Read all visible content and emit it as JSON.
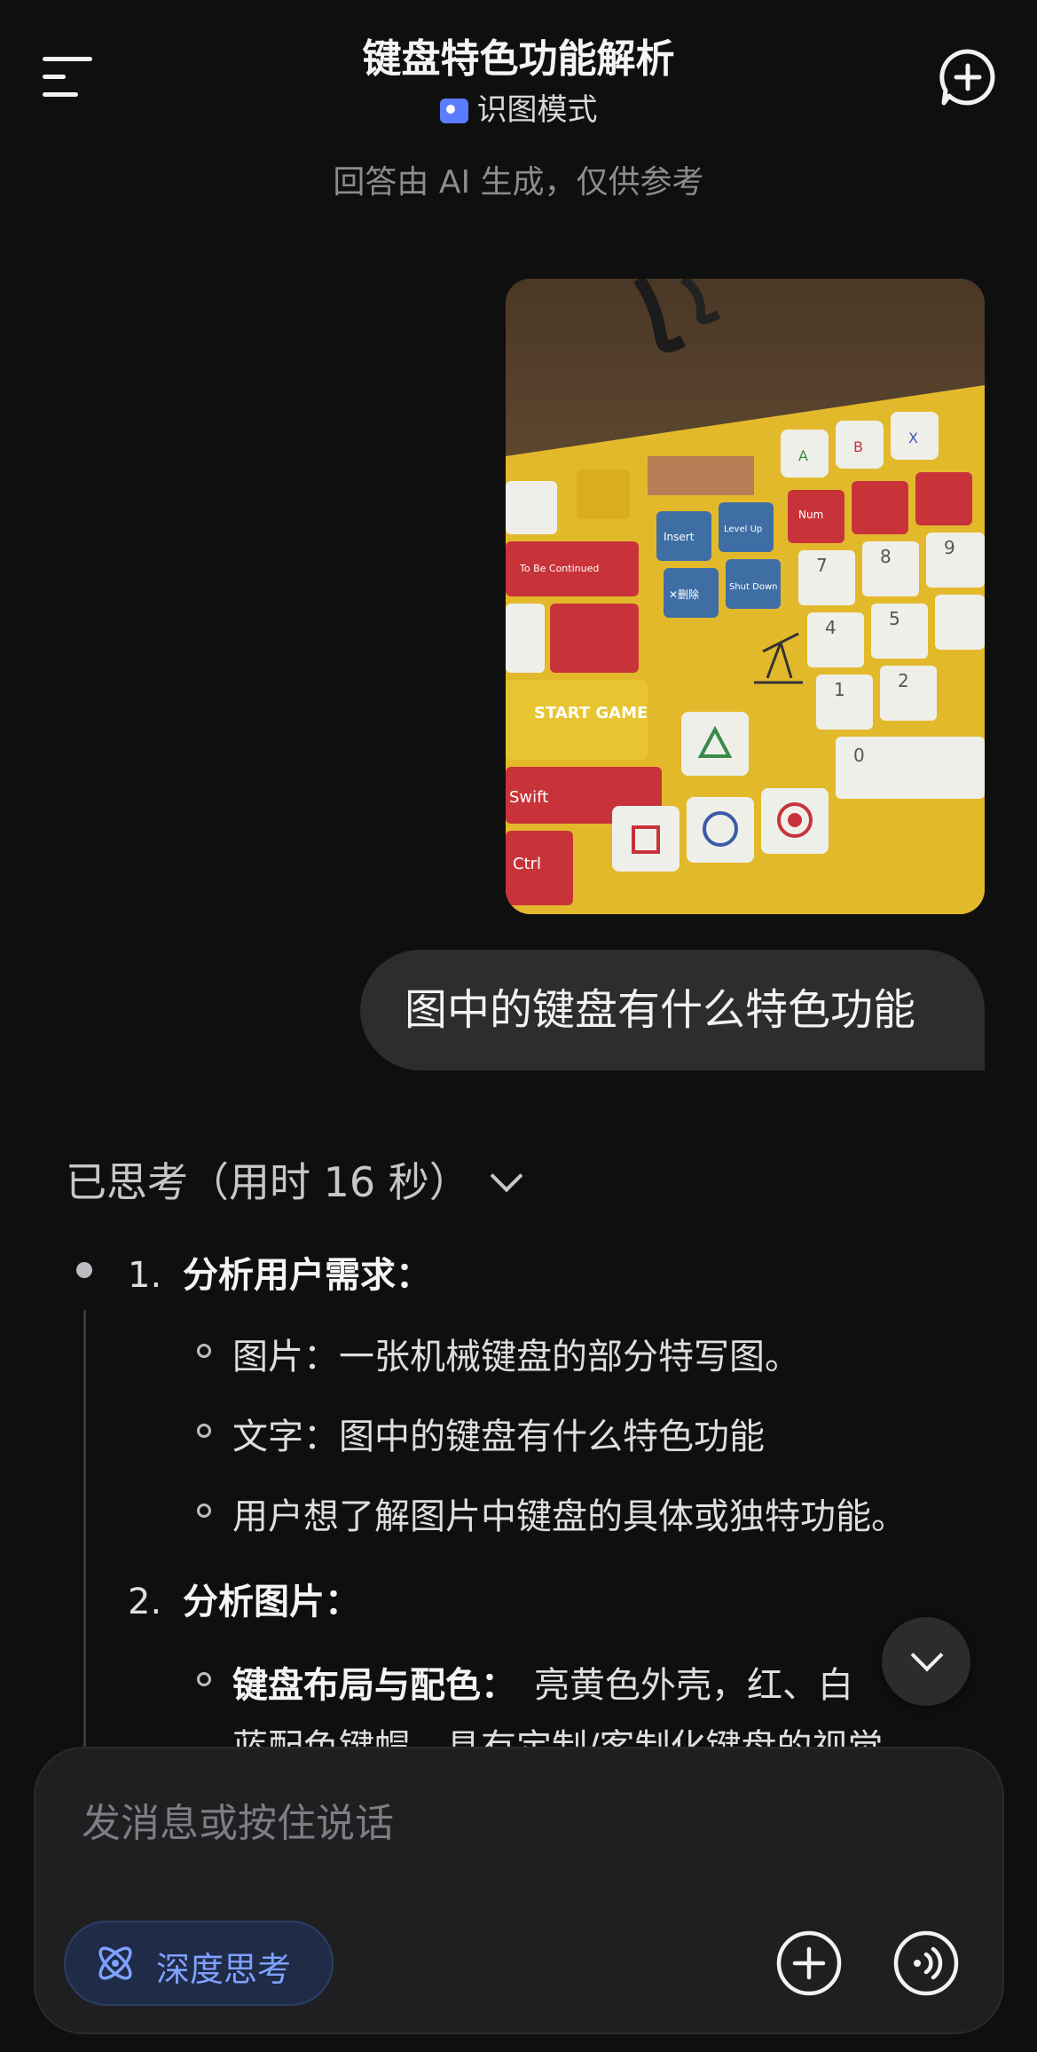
{
  "header": {
    "title": "键盘特色功能解析",
    "mode_label": "识图模式"
  },
  "disclaimer": "回答由 AI 生成，仅供参考",
  "user_message": "图中的键盘有什么特色功能",
  "thinking": {
    "header": "已思考（用时 16 秒）",
    "steps": [
      {
        "num": "1.",
        "title": "分析用户需求：",
        "items": [
          "图片：一张机械键盘的部分特写图。",
          "文字：图中的键盘有什么特色功能",
          "用户想了解图片中键盘的具体或独特功能。"
        ]
      },
      {
        "num": "2.",
        "title": "分析图片：",
        "items": [
          {
            "bold": "键盘布局与配色：",
            "text": "亮黄色外壳，红、白"
          },
          {
            "text": "蓝配色键帽，具有定制/客制化键盘的视觉"
          }
        ]
      }
    ]
  },
  "photo_keys": {
    "insert": "Insert",
    "level_up": "Level Up",
    "delete": "✕删除",
    "shutdown": "Shut Down",
    "start_game": "START GAME",
    "swift": "Swift",
    "ctrl": "Ctrl",
    "num": "Num",
    "continued": "To Be Continued",
    "d7": "7",
    "d8": "8",
    "d9": "9",
    "d4": "4",
    "d5": "5",
    "d1": "1",
    "d2": "2",
    "d0": "0",
    "btn_a": "A",
    "btn_b": "B",
    "btn_x": "X"
  },
  "composer": {
    "placeholder": "发消息或按住说话",
    "deep_think_label": "深度思考"
  },
  "icons": {
    "menu": "menu-icon",
    "new_chat": "new-chat-icon",
    "scroll_down": "chevron-down-icon",
    "plus": "plus-icon",
    "voice": "voice-call-icon",
    "deep_think": "atom-icon"
  },
  "colors": {
    "background": "#0f0f10",
    "bubble": "#2d2d30",
    "accent_blue": "#7fa1ff",
    "keyboard_yellow": "#e3b92c",
    "key_red": "#c8333a"
  }
}
